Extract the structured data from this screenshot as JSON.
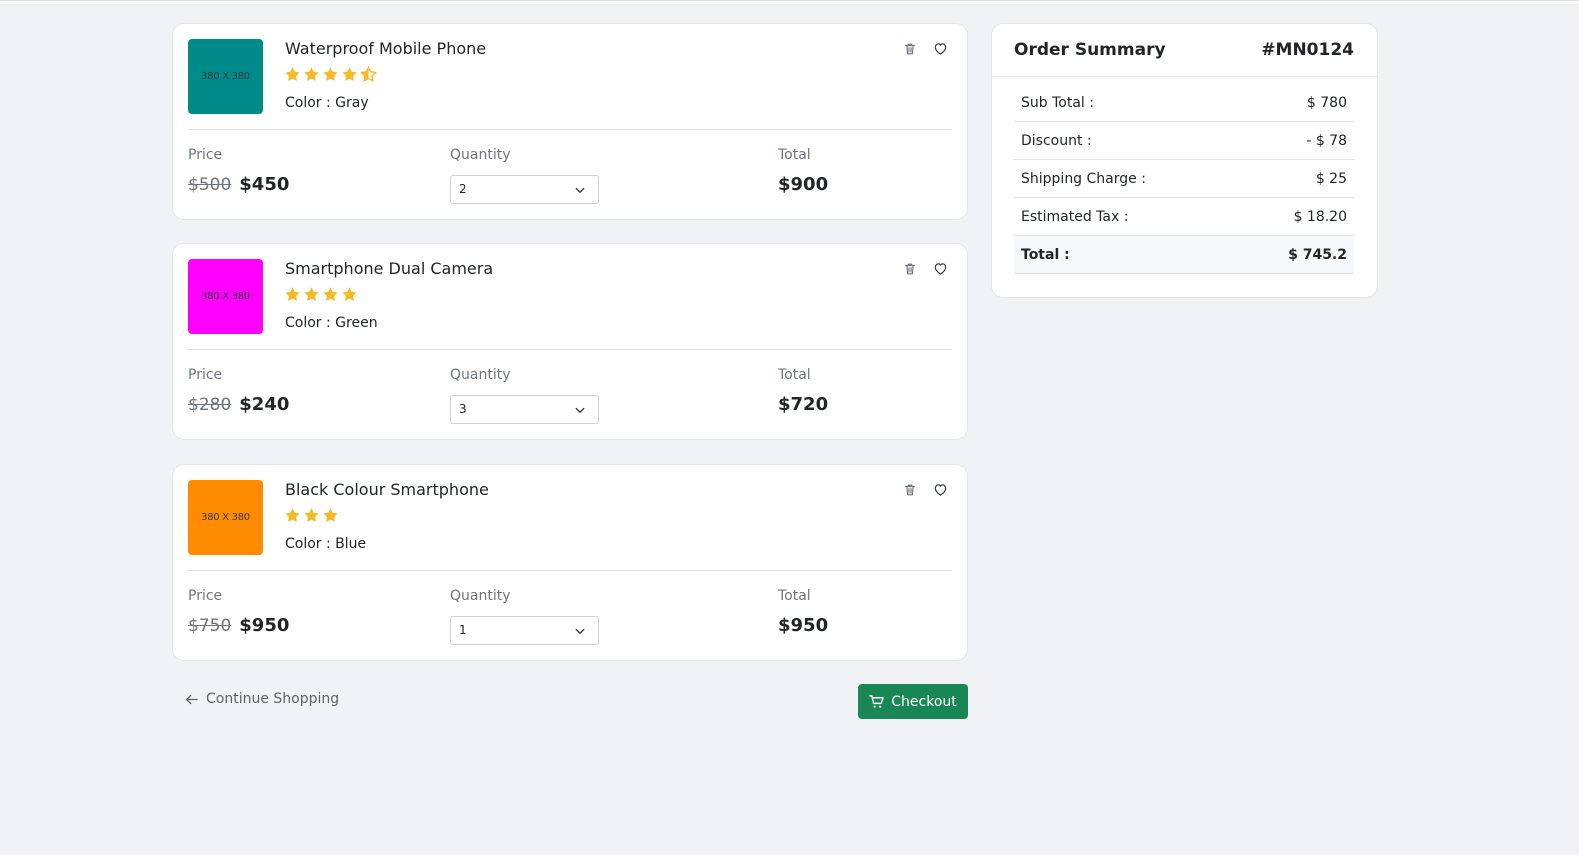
{
  "cart": {
    "items": [
      {
        "name": "Waterproof Mobile Phone",
        "image_label": "380 X 380",
        "image_color": "#008b8b",
        "rating": 4.5,
        "color_text": "Color : Gray",
        "price_label": "Price",
        "old_price": "$500",
        "new_price": "$450",
        "quantity_label": "Quantity",
        "quantity": "2",
        "total_label": "Total",
        "total": "$900"
      },
      {
        "name": "Smartphone Dual Camera",
        "image_label": "380 X 380",
        "image_color": "#ff00ff",
        "rating": 4,
        "color_text": "Color : Green",
        "price_label": "Price",
        "old_price": "$280",
        "new_price": "$240",
        "quantity_label": "Quantity",
        "quantity": "3",
        "total_label": "Total",
        "total": "$720"
      },
      {
        "name": "Black Colour Smartphone",
        "image_label": "380 X 380",
        "image_color": "#ff8c00",
        "rating": 3,
        "color_text": "Color : Blue",
        "price_label": "Price",
        "old_price": "$750",
        "new_price": "$950",
        "quantity_label": "Quantity",
        "quantity": "1",
        "total_label": "Total",
        "total": "$950"
      }
    ],
    "continue_label": "Continue Shopping",
    "checkout_label": "Checkout"
  },
  "summary": {
    "title": "Order Summary",
    "order_id": "#MN0124",
    "rows": [
      {
        "label": "Sub Total :",
        "value": "$ 780"
      },
      {
        "label": "Discount :",
        "value": "- $ 78"
      },
      {
        "label": "Shipping Charge :",
        "value": "$ 25"
      },
      {
        "label": "Estimated Tax :",
        "value": "$ 18.20"
      },
      {
        "label": "Total :",
        "value": "$ 745.2"
      }
    ]
  },
  "colors": {
    "star": "#f7b924",
    "checkout": "#198754"
  },
  "icons": {
    "delete": "trash-icon",
    "wishlist": "heart-icon",
    "select": "chevron-down-icon",
    "back": "arrow-left-icon",
    "checkout": "cart-icon"
  }
}
